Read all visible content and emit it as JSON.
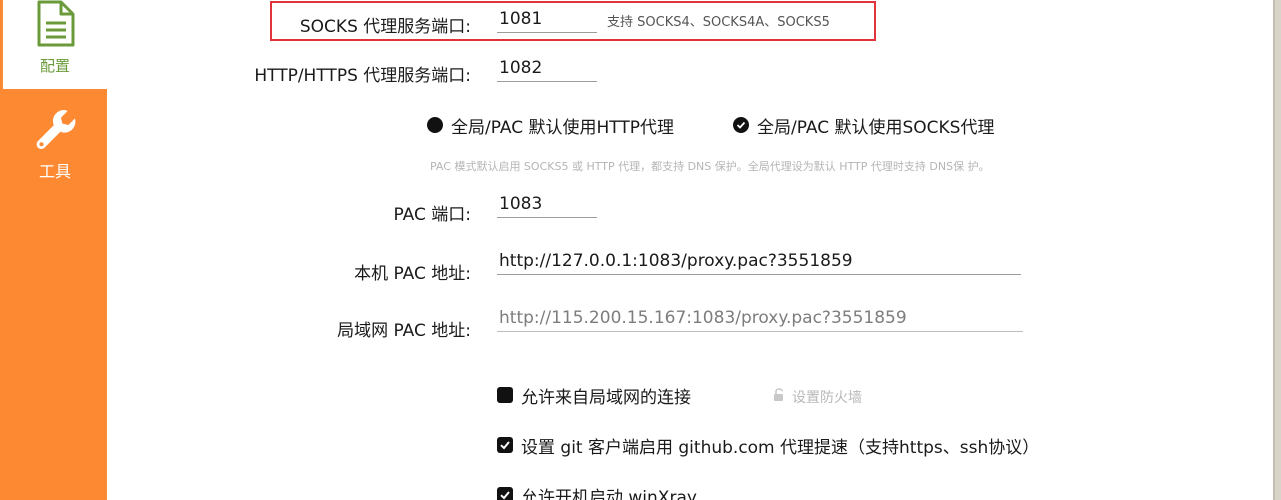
{
  "sidebar": {
    "config_label": "配置",
    "tools_label": "工具",
    "accent_color": "#fd8a33",
    "config_color": "#6b9a3a",
    "config_icon": "document-icon",
    "tools_icon": "wrench-icon"
  },
  "form": {
    "socks_label": "SOCKS 代理服务端口:",
    "socks_value": "1081",
    "socks_hint": "支持 SOCKS4、SOCKS4A、SOCKS5",
    "http_label": "HTTP/HTTPS 代理服务端口:",
    "http_value": "1082",
    "radio_http": "全局/PAC 默认使用HTTP代理",
    "radio_socks": "全局/PAC 默认使用SOCKS代理",
    "pac_note": "PAC 模式默认启用 SOCKS5 或 HTTP 代理，都支持 DNS 保护。全局代理设为默认 HTTP 代理时支持 DNS保 护。",
    "pac_port_label": "PAC 端口:",
    "pac_port_value": "1083",
    "local_pac_label": "本机 PAC 地址:",
    "local_pac_value": "http://127.0.0.1:1083/proxy.pac?3551859",
    "lan_pac_label": "局域网 PAC 地址:",
    "lan_pac_value": "http://115.200.15.167:1083/proxy.pac?3551859",
    "allow_lan_label": "允许来自局域网的连接",
    "firewall_label": "设置防火墙",
    "git_proxy_label": "设置 git 客户端启用 github.com 代理提速（支持https、ssh协议）",
    "autostart_label": "允许开机启动 winXray",
    "highlight_color": "#e0343a"
  }
}
